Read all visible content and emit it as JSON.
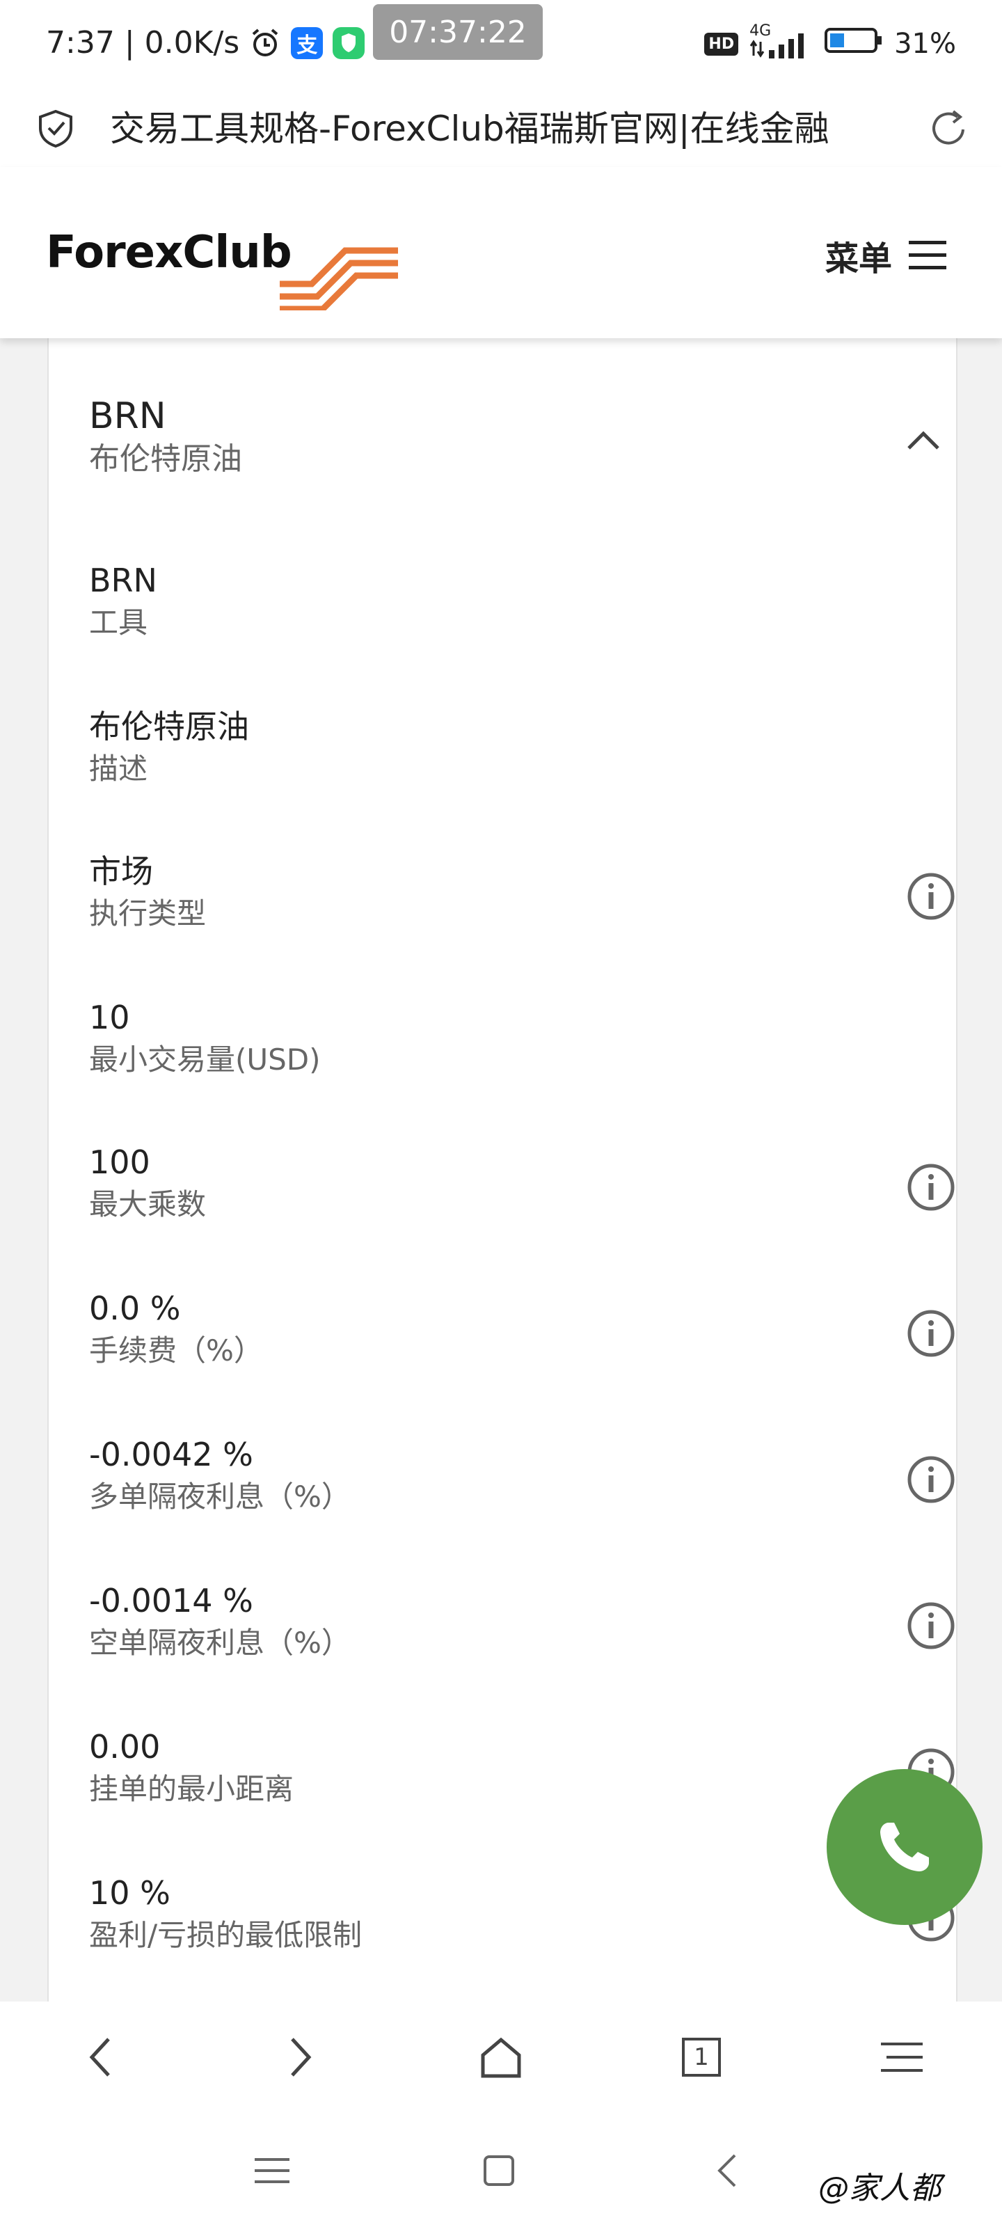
{
  "status_bar": {
    "time": "7:37",
    "separator": "|",
    "net_speed": "0.0K/s",
    "center_time": "07:37:22",
    "hd": "HD",
    "network": "4G",
    "battery": "31%",
    "icons": [
      "alarm-icon",
      "alipay-icon",
      "app-shield-icon",
      "signal-icon",
      "battery-icon"
    ]
  },
  "browser": {
    "page_title": "交易工具规格-ForexClub福瑞斯官网|在线金融",
    "icons": [
      "shield-check-icon",
      "reload-icon"
    ]
  },
  "header": {
    "logo_text": "ForexClub",
    "menu_label": "菜单",
    "brand_colors": {
      "logo_text": "#111111",
      "logo_stripes": "#e8793a"
    }
  },
  "instrument": {
    "code": "BRN",
    "name": "布伦特原油"
  },
  "specs": [
    {
      "value": "BRN",
      "label": "工具",
      "info": false
    },
    {
      "value": "布伦特原油",
      "label": "描述",
      "info": false
    },
    {
      "value": "市场",
      "label": "执行类型",
      "info": true
    },
    {
      "value": "10",
      "label": "最小交易量(USD)",
      "info": false
    },
    {
      "value": "100",
      "label": "最大乘数",
      "info": true
    },
    {
      "value": "0.0 %",
      "label": "手续费（%）",
      "info": true
    },
    {
      "value": "-0.0042 %",
      "label": "多单隔夜利息（%）",
      "info": true
    },
    {
      "value": "-0.0014 %",
      "label": "空单隔夜利息（%）",
      "info": true
    },
    {
      "value": "0.00",
      "label": "挂单的最小距离",
      "info": true
    },
    {
      "value": "10 %",
      "label": "盈利/亏损的最低限制",
      "info": true
    }
  ],
  "call_button": {
    "color": "#5a9e48"
  },
  "toolbar": {
    "tab_count": "1",
    "icons": [
      "back-icon",
      "forward-icon",
      "home-icon",
      "tabs-icon",
      "menu-icon"
    ]
  },
  "system_nav": {
    "watermark": "@家人都",
    "icons": [
      "recents-icon",
      "home-square-icon",
      "back-triangle-icon"
    ]
  }
}
